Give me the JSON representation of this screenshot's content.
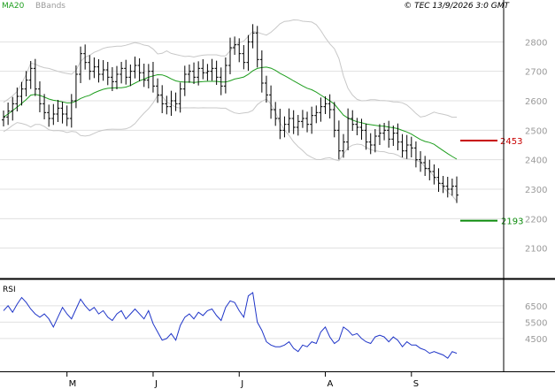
{
  "legend": {
    "ma": "MA20",
    "bbands": "BBands"
  },
  "copyright": "© TEC 13/9/2026 3:0 GMT",
  "colors": {
    "price": "#000000",
    "ma": "#1e9e1e",
    "bands": "#c8c8c8",
    "rsi": "#1f35c8",
    "resistance": "#c80000",
    "support": "#0a8a0a",
    "grid": "#e0e0e0"
  },
  "chart_data": [
    {
      "type": "ohlc",
      "ylim": [
        2000,
        2900
      ],
      "yticks": [
        2100,
        2200,
        2300,
        2400,
        2500,
        2600,
        2700,
        2800
      ],
      "months": [
        "M",
        "J",
        "J",
        "A",
        "S"
      ],
      "month_positions": [
        14,
        33,
        52,
        71,
        90
      ],
      "resistance": {
        "value": 2465,
        "label": "2453"
      },
      "support": {
        "value": 2193,
        "label": "2193"
      },
      "closes": [
        2545,
        2565,
        2590,
        2615,
        2640,
        2670,
        2710,
        2640,
        2590,
        2560,
        2540,
        2555,
        2575,
        2555,
        2540,
        2600,
        2690,
        2760,
        2730,
        2700,
        2715,
        2690,
        2705,
        2680,
        2665,
        2690,
        2710,
        2680,
        2700,
        2720,
        2695,
        2670,
        2700,
        2650,
        2620,
        2590,
        2580,
        2600,
        2590,
        2640,
        2690,
        2700,
        2680,
        2710,
        2695,
        2700,
        2710,
        2680,
        2650,
        2720,
        2780,
        2790,
        2760,
        2730,
        2800,
        2830,
        2740,
        2660,
        2620,
        2570,
        2540,
        2500,
        2520,
        2540,
        2510,
        2530,
        2540,
        2520,
        2550,
        2560,
        2580,
        2590,
        2570,
        2500,
        2430,
        2460,
        2540,
        2520,
        2510,
        2500,
        2460,
        2450,
        2480,
        2490,
        2500,
        2470,
        2490,
        2460,
        2430,
        2450,
        2440,
        2400,
        2390,
        2370,
        2360,
        2340,
        2320,
        2310,
        2300,
        2310,
        2280
      ]
    },
    {
      "type": "line",
      "name": "RSI",
      "yticks": [
        45,
        55,
        65
      ],
      "ytick_labels": [
        "4500",
        "5500",
        "6500"
      ],
      "values": [
        62,
        65,
        61,
        66,
        70,
        67,
        63,
        60,
        58,
        60,
        57,
        52,
        58,
        64,
        60,
        57,
        63,
        69,
        65,
        62,
        64,
        60,
        62,
        58,
        56,
        60,
        62,
        57,
        60,
        63,
        60,
        57,
        62,
        54,
        49,
        44,
        45,
        48,
        44,
        53,
        58,
        60,
        57,
        61,
        59,
        62,
        63,
        59,
        56,
        64,
        68,
        67,
        62,
        58,
        71,
        73,
        55,
        50,
        43,
        41,
        40,
        40,
        41,
        43,
        39,
        37,
        41,
        40,
        43,
        42,
        49,
        52,
        46,
        42,
        44,
        52,
        50,
        47,
        48,
        45,
        43,
        42,
        46,
        47,
        46,
        43,
        46,
        44,
        40,
        43,
        41,
        41,
        39,
        38,
        36,
        37,
        36,
        35,
        33,
        37,
        36
      ]
    }
  ]
}
